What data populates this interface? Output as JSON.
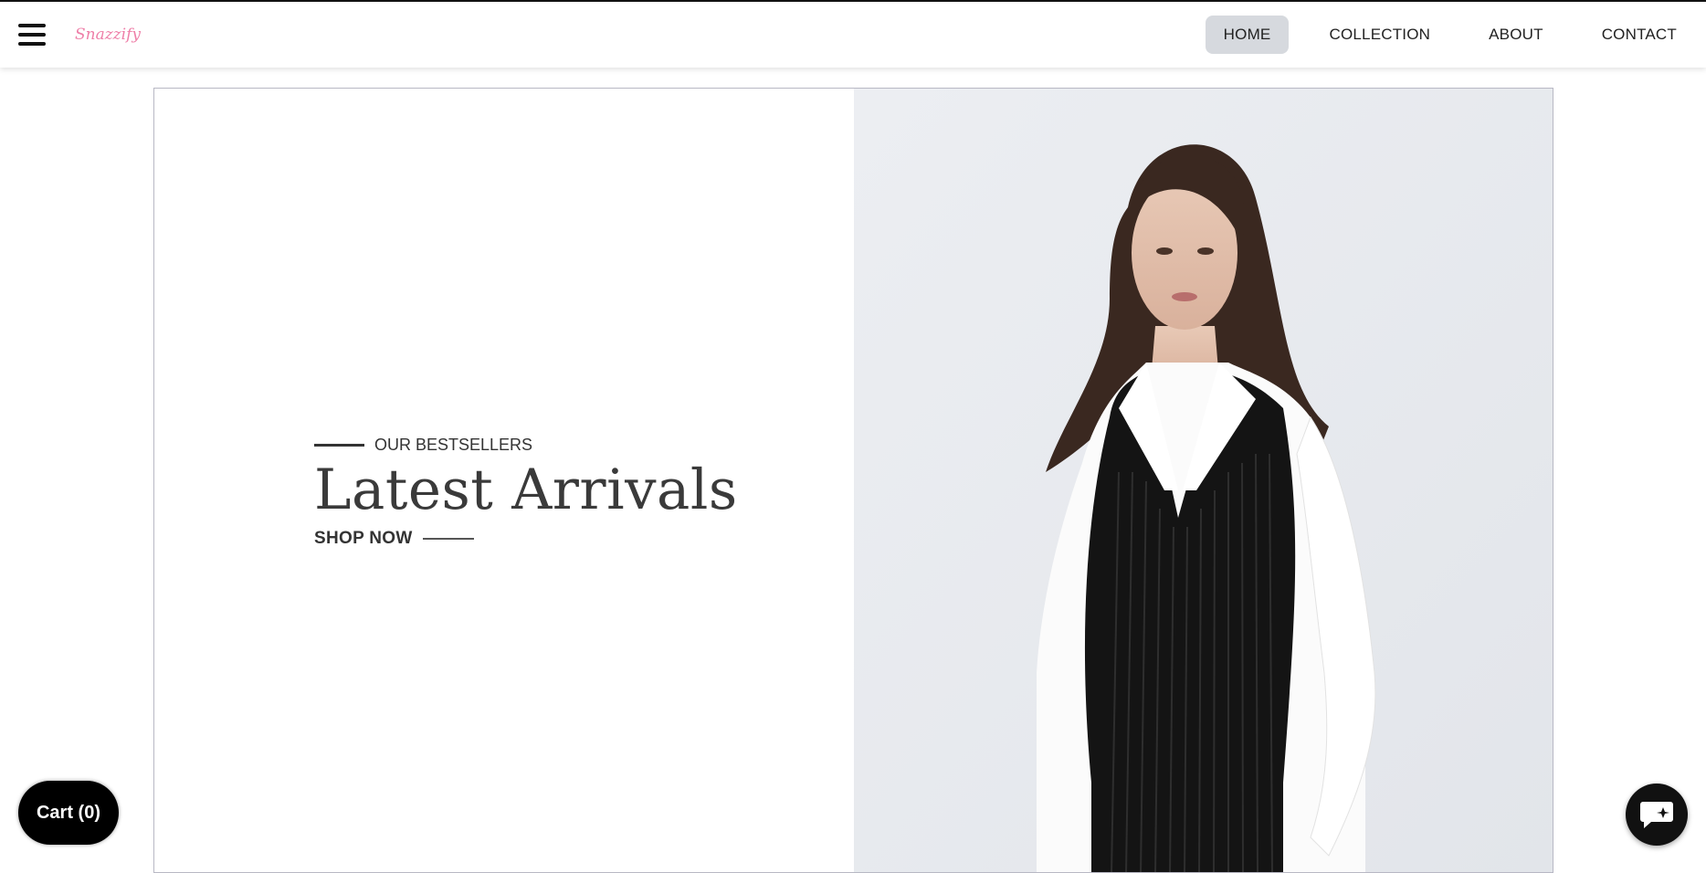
{
  "header": {
    "logo": "Snazzify",
    "nav": [
      {
        "label": "HOME",
        "active": true
      },
      {
        "label": "COLLECTION",
        "active": false
      },
      {
        "label": "ABOUT",
        "active": false
      },
      {
        "label": "CONTACT",
        "active": false
      }
    ],
    "menu_icon": "hamburger-icon"
  },
  "hero": {
    "eyebrow": "OUR BESTSELLERS",
    "title": "Latest Arrivals",
    "cta": "SHOP NOW",
    "image": "model-photo"
  },
  "cart": {
    "label": "Cart (0)"
  },
  "chat_icon": "chat-bubble-icon",
  "colors": {
    "logo": "#ee7fa8",
    "active_nav_bg": "#d6d9de",
    "cart_bg": "#000000",
    "hero_border": "#b8b8c4"
  }
}
